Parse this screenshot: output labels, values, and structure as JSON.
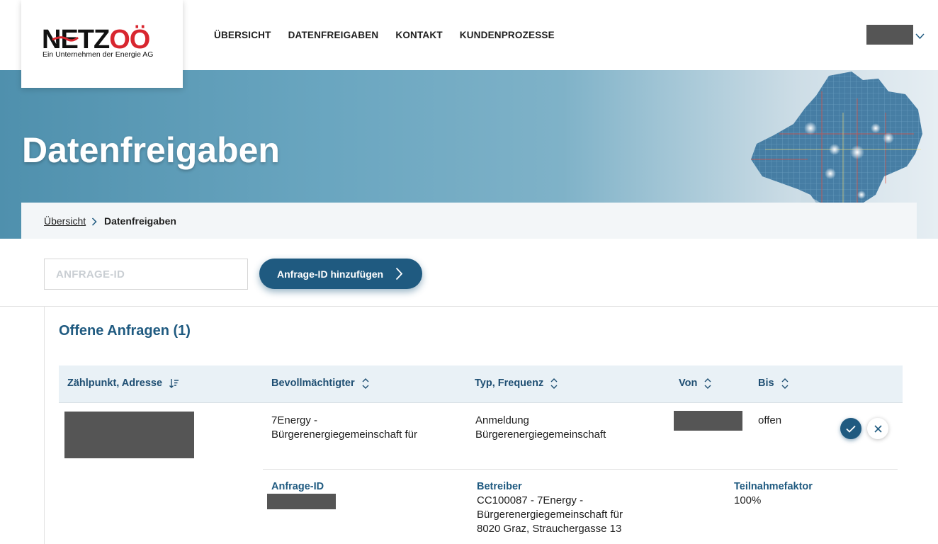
{
  "brand": {
    "logo_text_a": "NETZ",
    "logo_text_b": "OÖ",
    "logo_sub": "Ein Unternehmen der Energie AG",
    "accent": "#d8262f",
    "primary": "#1f5a80"
  },
  "nav": {
    "items": [
      "ÜBERSICHT",
      "DATENFREIGABEN",
      "KONTAKT",
      "KUNDENPROZESSE"
    ]
  },
  "hero": {
    "title": "Datenfreigaben"
  },
  "breadcrumb": {
    "items": [
      "Übersicht",
      "Datenfreigaben"
    ]
  },
  "search": {
    "placeholder": "ANFRAGE-ID",
    "value": "",
    "button_label": "Anfrage-ID hinzufügen"
  },
  "section": {
    "title": "Offene Anfragen (1)"
  },
  "table": {
    "columns": [
      "Zählpunkt, Adresse",
      "Bevollmächtigter",
      "Typ, Frequenz",
      "Von",
      "Bis"
    ],
    "rows": [
      {
        "bevollmaechtigter_line1": "7Energy -",
        "bevollmaechtigter_line2": "Bürgerenergiegemeinschaft für",
        "typ_line1": "Anmeldung",
        "typ_line2": "Bürgerenergiegemeinschaft",
        "bis": "offen",
        "details": {
          "anfrage_label": "Anfrage-ID",
          "betreiber_label": "Betreiber",
          "betreiber_line1": "CC100087 - 7Energy -",
          "betreiber_line2": "Bürgerenergiegemeinschaft für",
          "betreiber_line3": "8020 Graz, Strauchergasse 13",
          "teilnahme_label": "Teilnahmefaktor",
          "teilnahme_value": "100%"
        }
      }
    ]
  },
  "icons": {
    "sort_active": "sort-descending-icon",
    "sort": "sort-updown-icon",
    "approve": "check-icon",
    "reject": "close-icon",
    "breadcrumb_sep": "chevron-right-icon",
    "user_menu": "chevron-down-icon"
  }
}
